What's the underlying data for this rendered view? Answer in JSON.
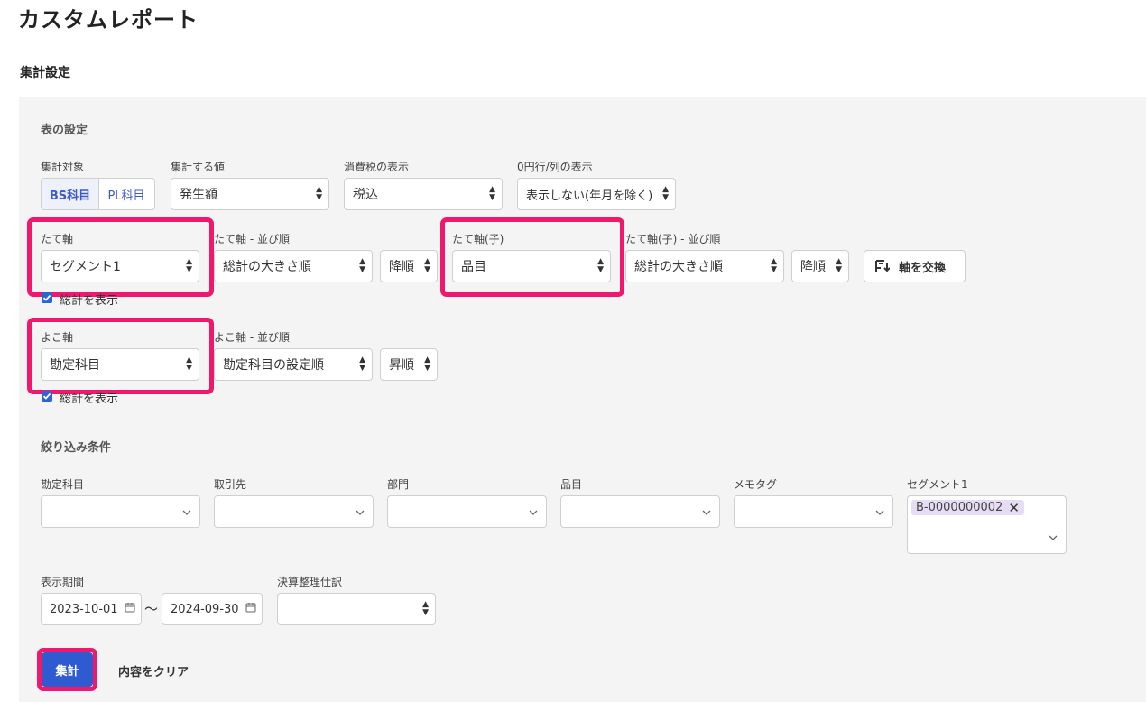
{
  "page": {
    "title": "カスタムレポート",
    "section": "集計設定"
  },
  "table_settings": {
    "title": "表の設定",
    "target": {
      "label": "集計対象",
      "options": [
        "BS科目",
        "PL科目"
      ],
      "selected": "BS科目"
    },
    "value": {
      "label": "集計する値",
      "selected": "発生額"
    },
    "tax": {
      "label": "消費税の表示",
      "selected": "税込"
    },
    "zero": {
      "label": "0円行/列の表示",
      "selected": "表示しない(年月を除く)"
    },
    "vertical": {
      "label": "たて軸",
      "selected": "セグメント1",
      "total_label": "総計を表示"
    },
    "vertical_order": {
      "label": "たて軸 - 並び順",
      "selected": "総計の大きさ順",
      "direction": "降順"
    },
    "vertical_child": {
      "label": "たて軸(子)",
      "selected": "品目"
    },
    "vertical_child_order": {
      "label": "たて軸(子) - 並び順",
      "selected": "総計の大きさ順",
      "direction": "降順"
    },
    "swap_label": "軸を交換",
    "horizontal": {
      "label": "よこ軸",
      "selected": "勘定科目",
      "total_label": "総計を表示"
    },
    "horizontal_order": {
      "label": "よこ軸 - 並び順",
      "selected": "勘定科目の設定順",
      "direction": "昇順"
    }
  },
  "filters": {
    "title": "絞り込み条件",
    "account": {
      "label": "勘定科目"
    },
    "partner": {
      "label": "取引先"
    },
    "department": {
      "label": "部門"
    },
    "item": {
      "label": "品目"
    },
    "memo_tag": {
      "label": "メモタグ"
    },
    "segment1": {
      "label": "セグメント1",
      "tag": "B-0000000002"
    },
    "period": {
      "label": "表示期間",
      "start": "2023-10-01",
      "separator": "〜",
      "end": "2024-09-30"
    },
    "closing": {
      "label": "決算整理仕訳"
    }
  },
  "actions": {
    "submit": "集計",
    "clear": "内容をクリア"
  },
  "colors": {
    "accent": "#2f5bd0",
    "highlight": "#f0186c",
    "tag_bg": "#e6ddf5"
  }
}
